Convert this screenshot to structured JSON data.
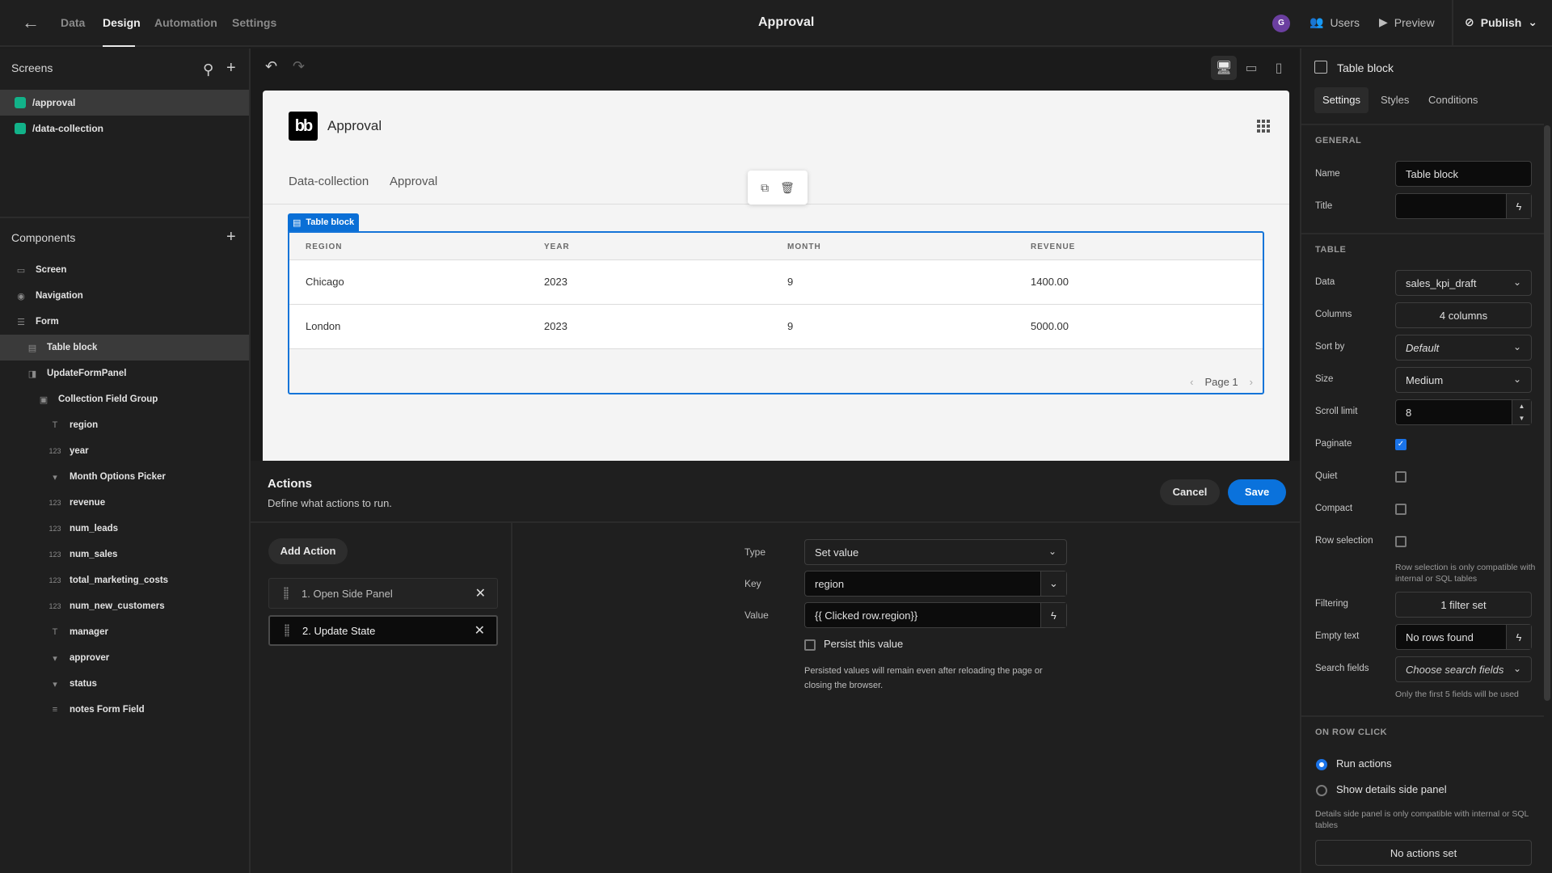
{
  "topbar": {
    "nav_tabs": [
      "Data",
      "Design",
      "Automation",
      "Settings"
    ],
    "active_tab": "Design",
    "app_title": "Approval",
    "avatar_initial": "G",
    "users_label": "Users",
    "preview_label": "Preview",
    "publish_label": "Publish"
  },
  "left": {
    "screens_heading": "Screens",
    "screens": [
      {
        "route": "/approval",
        "selected": true
      },
      {
        "route": "/data-collection",
        "selected": false
      }
    ],
    "components_heading": "Components",
    "components": [
      {
        "label": "Screen",
        "icon": "screen-icon",
        "glyph": "▭",
        "depth": 0
      },
      {
        "label": "Navigation",
        "icon": "eye-icon",
        "glyph": "◉",
        "depth": 0
      },
      {
        "label": "Form",
        "icon": "form-icon",
        "glyph": "☰",
        "depth": 0
      },
      {
        "label": "Table block",
        "icon": "table-icon",
        "glyph": "▤",
        "depth": 1,
        "selected": true
      },
      {
        "label": "UpdateFormPanel",
        "icon": "side-panel-icon",
        "glyph": "◨",
        "depth": 1
      },
      {
        "label": "Collection Field Group",
        "icon": "field-group-icon",
        "glyph": "▣",
        "depth": 2
      },
      {
        "label": "region",
        "icon": "text-field-icon",
        "glyph": "T",
        "depth": 3
      },
      {
        "label": "year",
        "icon": "number-field-icon",
        "glyph": "123",
        "depth": 3
      },
      {
        "label": "Month Options Picker",
        "icon": "options-picker-icon",
        "glyph": "▾",
        "depth": 3
      },
      {
        "label": "revenue",
        "icon": "number-field-icon",
        "glyph": "123",
        "depth": 3
      },
      {
        "label": "num_leads",
        "icon": "number-field-icon",
        "glyph": "123",
        "depth": 3
      },
      {
        "label": "num_sales",
        "icon": "number-field-icon",
        "glyph": "123",
        "depth": 3
      },
      {
        "label": "total_marketing_costs",
        "icon": "number-field-icon",
        "glyph": "123",
        "depth": 3
      },
      {
        "label": "num_new_customers",
        "icon": "number-field-icon",
        "glyph": "123",
        "depth": 3
      },
      {
        "label": "manager",
        "icon": "text-field-icon",
        "glyph": "T",
        "depth": 3
      },
      {
        "label": "approver",
        "icon": "options-picker-icon",
        "glyph": "▾",
        "depth": 3
      },
      {
        "label": "status",
        "icon": "options-picker-icon",
        "glyph": "▾",
        "depth": 3
      },
      {
        "label": "notes Form Field",
        "icon": "long-form-icon",
        "glyph": "≡",
        "depth": 3
      }
    ]
  },
  "canvas": {
    "page": {
      "logo_text": "bb",
      "title": "Approval",
      "nav_links": [
        "Data-collection",
        "Approval"
      ]
    },
    "table_tag": "Table block",
    "table": {
      "columns": [
        "REGION",
        "YEAR",
        "MONTH",
        "REVENUE"
      ],
      "rows": [
        [
          "Chicago",
          "2023",
          "9",
          "1400.00"
        ],
        [
          "London",
          "2023",
          "9",
          "5000.00"
        ]
      ],
      "page_label": "Page 1"
    }
  },
  "actions": {
    "title": "Actions",
    "subtitle": "Define what actions to run.",
    "cancel_label": "Cancel",
    "save_label": "Save",
    "add_action_label": "Add Action",
    "list": [
      {
        "label": "1. Open Side Panel",
        "selected": false
      },
      {
        "label": "2. Update State",
        "selected": true
      }
    ],
    "form": {
      "type_label": "Type",
      "type_value": "Set value",
      "key_label": "Key",
      "key_value": "region",
      "value_label": "Value",
      "value_value": "{{ Clicked row.region}}",
      "persist_label": "Persist this value",
      "persist_checked": false,
      "persist_note": "Persisted values will remain even after reloading the page or closing the browser."
    }
  },
  "right": {
    "title": "Table block",
    "tabs": [
      "Settings",
      "Styles",
      "Conditions"
    ],
    "active_tab": "Settings",
    "general_heading": "GENERAL",
    "name_label": "Name",
    "name_value": "Table block",
    "title_label": "Title",
    "title_value": "",
    "table_heading": "TABLE",
    "data_label": "Data",
    "data_value": "sales_kpi_draft",
    "columns_label": "Columns",
    "columns_value": "4 columns",
    "sortby_label": "Sort by",
    "sortby_value": "Default",
    "size_label": "Size",
    "size_value": "Medium",
    "scroll_label": "Scroll limit",
    "scroll_value": "8",
    "paginate_label": "Paginate",
    "paginate_checked": true,
    "quiet_label": "Quiet",
    "quiet_checked": false,
    "compact_label": "Compact",
    "compact_checked": false,
    "rowsel_label": "Row selection",
    "rowsel_checked": false,
    "rowsel_note": "Row selection is only compatible with internal or SQL tables",
    "filtering_label": "Filtering",
    "filtering_value": "1 filter set",
    "empty_label": "Empty text",
    "empty_value": "No rows found",
    "search_label": "Search fields",
    "search_placeholder": "Choose search fields",
    "search_note": "Only the first 5 fields will be used",
    "rowclick_heading": "ON ROW CLICK",
    "run_actions_label": "Run actions",
    "show_details_label": "Show details side panel",
    "rowclick_selected": "Run actions",
    "details_note": "Details side panel is only compatible with internal or SQL tables",
    "no_actions_label": "No actions set"
  },
  "colors": {
    "accent": "#0a72dc",
    "screen_dot": "#12b289",
    "avatar": "#6b3fa0"
  }
}
